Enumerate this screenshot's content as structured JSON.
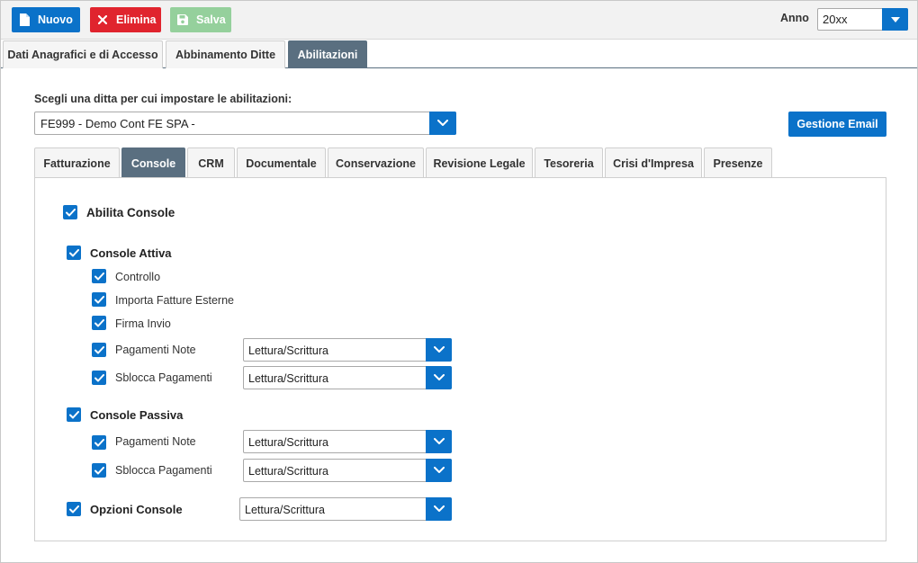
{
  "toolbar": {
    "nuovo": "Nuovo",
    "elimina": "Elimina",
    "salva": "Salva",
    "anno_label": "Anno",
    "anno_value": "20xx"
  },
  "main_tabs": [
    {
      "label": "Dati Anagrafici e di Accesso"
    },
    {
      "label": "Abbinamento Ditte"
    },
    {
      "label": "Abilitazioni"
    }
  ],
  "ditta": {
    "label": "Scegli una ditta per cui impostare le abilitazioni:",
    "value": "FE999 - Demo Cont FE SPA -"
  },
  "gestione_email": "Gestione Email",
  "sub_tabs": [
    {
      "label": "Fatturazione"
    },
    {
      "label": "Console"
    },
    {
      "label": "CRM"
    },
    {
      "label": "Documentale"
    },
    {
      "label": "Conservazione"
    },
    {
      "label": "Revisione Legale"
    },
    {
      "label": "Tesoreria"
    },
    {
      "label": "Crisi d'Impresa"
    },
    {
      "label": "Presenze"
    }
  ],
  "console": {
    "abilita": "Abilita Console",
    "attiva": {
      "label": "Console Attiva",
      "controllo": "Controllo",
      "importa": "Importa Fatture Esterne",
      "firma": "Firma Invio",
      "pagamenti_note": "Pagamenti Note",
      "pagamenti_note_value": "Lettura/Scrittura",
      "sblocca": "Sblocca Pagamenti",
      "sblocca_value": "Lettura/Scrittura"
    },
    "passiva": {
      "label": "Console Passiva",
      "pagamenti_note": "Pagamenti Note",
      "pagamenti_note_value": "Lettura/Scrittura",
      "sblocca": "Sblocca Pagamenti",
      "sblocca_value": "Lettura/Scrittura"
    },
    "opzioni": {
      "label": "Opzioni Console",
      "value": "Lettura/Scrittura"
    }
  },
  "colors": {
    "primary": "#0b72c9",
    "danger": "#e0242e",
    "success_disabled": "#95d09c",
    "tab_active": "#5a6f80"
  }
}
